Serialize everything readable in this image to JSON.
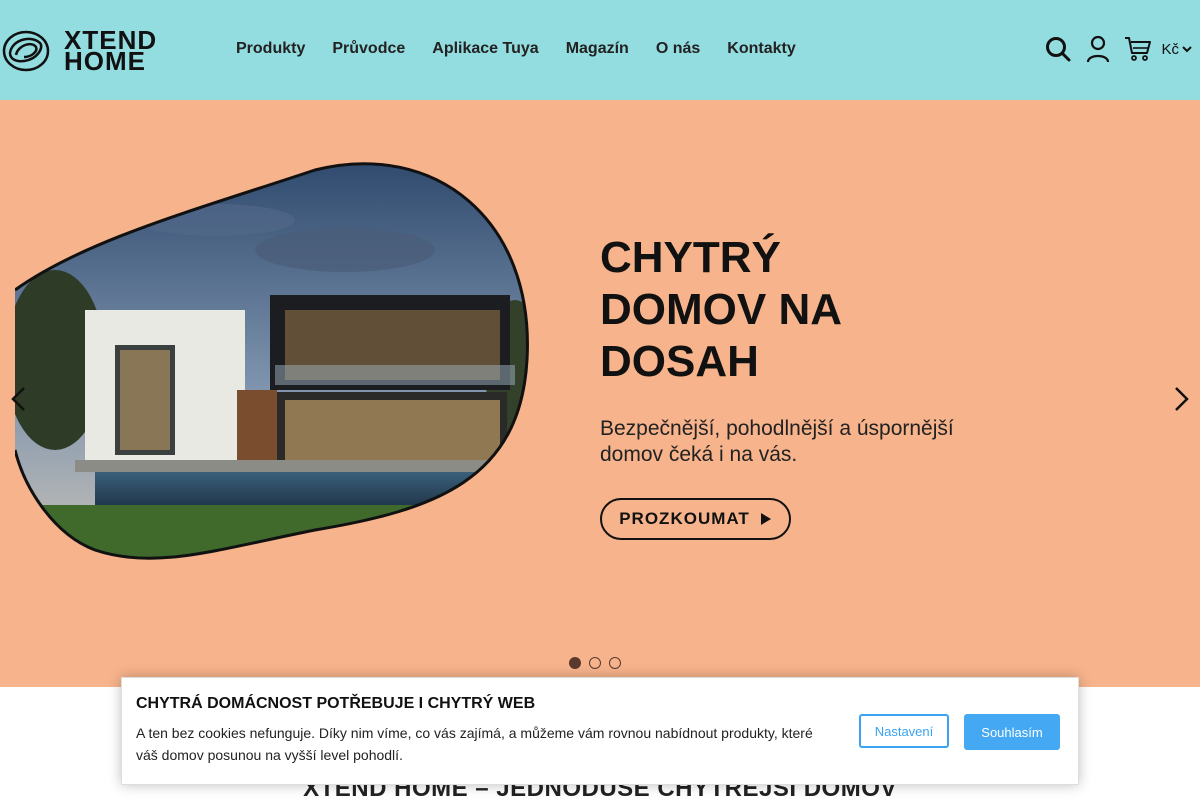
{
  "brand": {
    "line1": "XTEND",
    "line2": "HOME"
  },
  "nav": {
    "items": [
      {
        "label": "Produkty"
      },
      {
        "label": "Průvodce"
      },
      {
        "label": "Aplikace Tuya"
      },
      {
        "label": "Magazín"
      },
      {
        "label": "O nás"
      },
      {
        "label": "Kontakty"
      }
    ]
  },
  "header_tools": {
    "currency": "Kč"
  },
  "hero": {
    "title_lines": [
      "CHYTRÝ",
      "DOMOV NA",
      "DOSAH"
    ],
    "subtitle": "Bezpečnější, pohodlnější a úspornější domov čeká i na vás.",
    "button_label": "PROZKOUMAT",
    "slides_total": 3,
    "active_slide": 1
  },
  "section": {
    "heading": "XTEND HOME – JEDNODUŠE CHYTŘEJŠÍ DOMOV"
  },
  "cookie": {
    "title": "CHYTRÁ DOMÁCNOST POTŘEBUJE I CHYTRÝ WEB",
    "text": "A ten bez cookies nefunguje. Díky nim víme, co vás zajímá, a můžeme vám rovnou nabídnout produkty, které váš domov posunou na vyšší level pohodlí.",
    "settings_label": "Nastavení",
    "accept_label": "Souhlasím"
  },
  "colors": {
    "header_bg": "#93dce0",
    "hero_bg": "#f7b38b",
    "accent_blue": "#45a8f2"
  }
}
